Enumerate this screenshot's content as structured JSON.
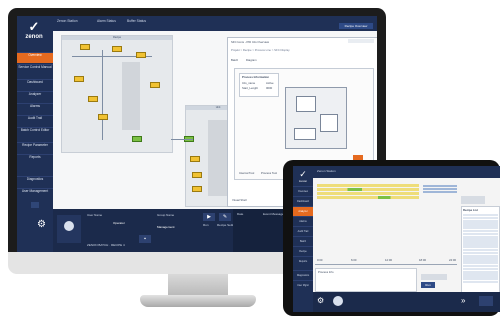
{
  "app": {
    "brand": "zenon"
  },
  "monitor": {
    "topbar": {
      "tab1": "Zenon Station",
      "tab2": "Alarm Status",
      "tab3": "Buffer Status",
      "right_button": "Recipe Overview"
    },
    "sidebar": {
      "items": [
        "Overview",
        "Service Control Manual",
        "Dashboard",
        "Analyzer",
        "Alarms",
        "Audit Trail",
        "Batch Control Editor",
        "Recipe Parameter",
        "Reports",
        "Diagnostics",
        "User Management"
      ],
      "active_index": 0
    },
    "canvas": {
      "panel1_title": "Recipe",
      "panel2_title": "Unit",
      "popup": {
        "title": "SFC Icons - PID Info Overview",
        "path": "Projekt > Recipe > Process Line > SFC Display",
        "tab1": "Batch",
        "tab2": "Diagram",
        "inner_title": "Process Information",
        "row1_label": "Info_name",
        "row1_value": "Active",
        "row2_label": "Start_Lenght",
        "row2_value": "0000",
        "footer_tab1": "Internal Tool",
        "footer_tab2": "Process Tool",
        "status": "Visual Shell"
      }
    },
    "bottom": {
      "field1_label": "User Name",
      "field1_value": "Operator",
      "field2_label": "Group Name",
      "field2_value": "Management",
      "field3_label": "Authorized Group",
      "field3_value": "Supervisor",
      "btn_label": "Run",
      "btn2_label": "Recipe Settings",
      "col_head": "Date",
      "col_head2": "Event Message",
      "footer": "ZENON BATCH  ·  RECIPE 4"
    }
  },
  "tablet": {
    "topbar": {
      "title": "Zenon Station"
    },
    "sidebar": {
      "items": [
        "Overview",
        "Dashboard",
        "Analyzer",
        "Alarms",
        "Audit Trail",
        "Batch",
        "Recipe",
        "Reports",
        "Diagnostics",
        "User Mgmt"
      ],
      "active_index": 2
    },
    "axis_labels": [
      "0:00",
      "6:00",
      "12:00",
      "18:00",
      "24:00"
    ],
    "status_left": "Process Info",
    "button_label": "Run",
    "list_title": "Recipe List"
  }
}
